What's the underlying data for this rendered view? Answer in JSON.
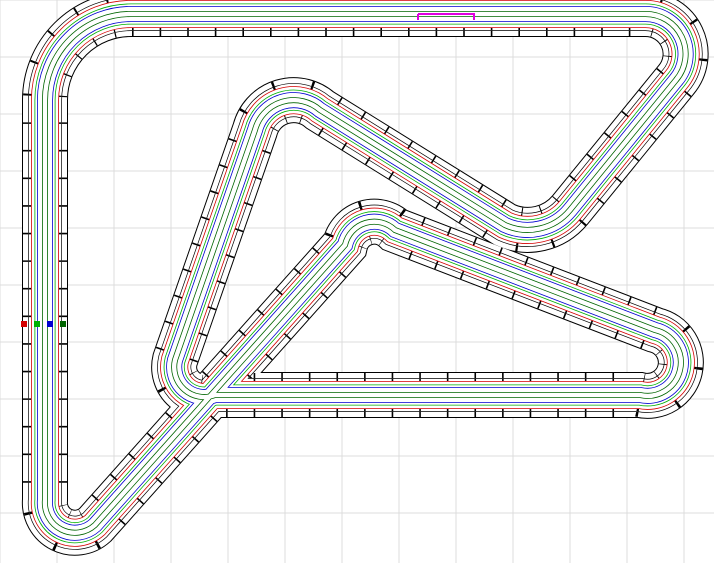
{
  "view": {
    "name": "slot-car-track-layout",
    "background": "#ffffff",
    "grid_color": "#dcdcdc",
    "show_grid": true
  },
  "track": {
    "lanes": [
      {
        "color": "#d40000"
      },
      {
        "color": "#00b000"
      },
      {
        "color": "#0000d0"
      },
      {
        "color": "#006400"
      }
    ],
    "border_color": "#000000",
    "selected_segment_color": "#e000e0",
    "start_markers": [
      "#d40000",
      "#00b000",
      "#0000d0",
      "#006400"
    ]
  }
}
